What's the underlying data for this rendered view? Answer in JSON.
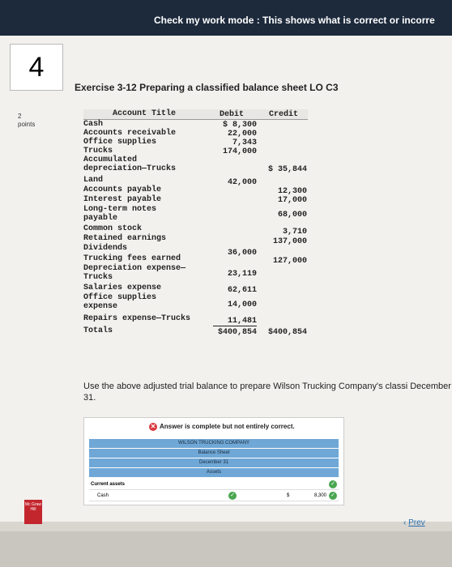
{
  "header": {
    "mode_text": "Check my work mode : This shows what is correct or incorre"
  },
  "question": {
    "number": "4",
    "points_value": "2",
    "points_label": "points"
  },
  "exercise_title": "Exercise 3-12 Preparing a classified balance sheet LO C3",
  "trial_balance": {
    "headers": {
      "account": "Account Title",
      "debit": "Debit",
      "credit": "Credit"
    },
    "rows": [
      {
        "account": "Cash",
        "debit": "$  8,300",
        "credit": ""
      },
      {
        "account": "Accounts receivable",
        "debit": "22,000",
        "credit": ""
      },
      {
        "account": "Office supplies",
        "debit": "7,343",
        "credit": ""
      },
      {
        "account": "Trucks",
        "debit": "174,000",
        "credit": ""
      },
      {
        "account": "Accumulated depreciation—Trucks",
        "debit": "",
        "credit": "$ 35,844"
      },
      {
        "account": "Land",
        "debit": "42,000",
        "credit": ""
      },
      {
        "account": "Accounts payable",
        "debit": "",
        "credit": "12,300"
      },
      {
        "account": "Interest payable",
        "debit": "",
        "credit": "17,000"
      },
      {
        "account": "Long-term notes payable",
        "debit": "",
        "credit": "68,000"
      },
      {
        "account": "Common stock",
        "debit": "",
        "credit": "3,710"
      },
      {
        "account": "Retained earnings",
        "debit": "",
        "credit": "137,000"
      },
      {
        "account": "Dividends",
        "debit": "36,000",
        "credit": ""
      },
      {
        "account": "Trucking fees earned",
        "debit": "",
        "credit": "127,000"
      },
      {
        "account": "Depreciation expense—Trucks",
        "debit": "23,119",
        "credit": ""
      },
      {
        "account": "Salaries expense",
        "debit": "62,611",
        "credit": ""
      },
      {
        "account": "Office supplies expense",
        "debit": "14,000",
        "credit": ""
      },
      {
        "account": "Repairs expense—Trucks",
        "debit": "11,481",
        "credit": ""
      },
      {
        "account": "Totals",
        "debit": "$400,854",
        "credit": "$400,854"
      }
    ]
  },
  "prompt": "Use the above adjusted trial balance to prepare Wilson Trucking Company's classi December 31.",
  "answer": {
    "status": "Answer is complete but not entirely correct.",
    "company": "WILSON TRUCKING COMPANY",
    "statement": "Balance Sheet",
    "date": "December 31",
    "section": "Assets",
    "subsection": "Current assets",
    "line_label": "Cash",
    "line_currency": "$",
    "line_value": "8,300"
  },
  "footer": {
    "logo_text": "Mc Graw Hill",
    "prev_label": "Prev"
  },
  "colors": {
    "topbar": "#1d2a3c",
    "table_header": "#6fa7d6",
    "check": "#4aa650",
    "error": "#d9363e"
  }
}
